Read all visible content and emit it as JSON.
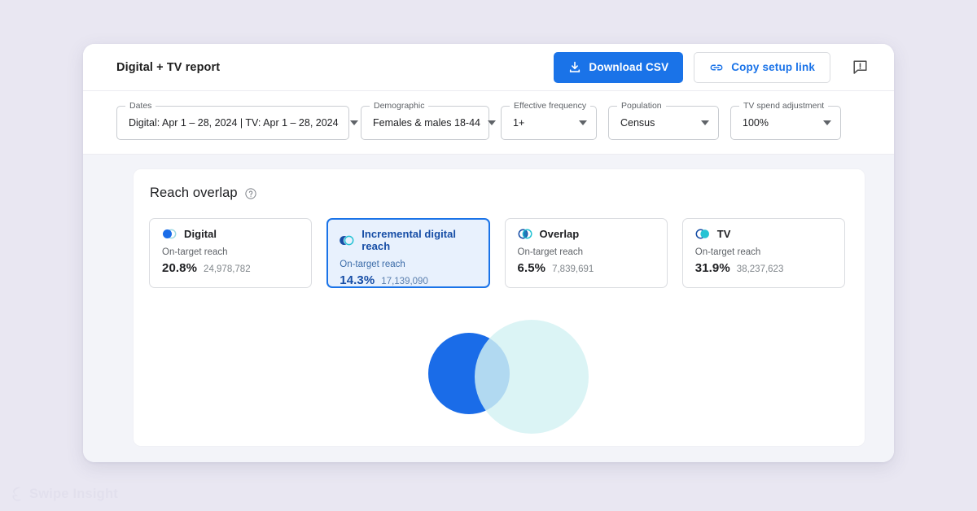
{
  "watermark": {
    "label": "Swipe Insight",
    "logo_icon": "swipe-s-logo-icon"
  },
  "window": {
    "title": "Digital + TV report",
    "actions": {
      "download_label": "Download CSV",
      "download_icon": "download-icon",
      "copy_label": "Copy setup link",
      "copy_icon": "link-icon",
      "feedback_icon": "feedback-comment-icon"
    }
  },
  "filters": [
    {
      "name": "dates",
      "label": "Dates",
      "value": "Digital: Apr 1 – 28, 2024 | TV: Apr 1 – 28, 2024"
    },
    {
      "name": "demographic",
      "label": "Demographic",
      "value": "Females & males 18-44"
    },
    {
      "name": "effective-frequency",
      "label": "Effective frequency",
      "value": "1+"
    },
    {
      "name": "population",
      "label": "Population",
      "value": "Census"
    },
    {
      "name": "tv-spend-adjustment",
      "label": "TV spend adjustment",
      "value": "100%"
    }
  ],
  "panel": {
    "title": "Reach overlap",
    "help_icon": "help-circle-icon",
    "metric_sublabel": "On-target reach",
    "cards": [
      {
        "name": "digital",
        "label": "Digital",
        "icon": "venn-digital-icon",
        "sublabel": "On-target reach",
        "percent": "20.8%",
        "absolute": "24,978,782",
        "selected": false
      },
      {
        "name": "incremental-digital-reach",
        "label": "Incremental digital reach",
        "icon": "venn-incremental-icon",
        "sublabel": "On-target reach",
        "percent": "14.3%",
        "absolute": "17,139,090",
        "selected": true
      },
      {
        "name": "overlap",
        "label": "Overlap",
        "icon": "venn-overlap-icon",
        "sublabel": "On-target reach",
        "percent": "6.5%",
        "absolute": "7,839,691",
        "selected": false
      },
      {
        "name": "tv",
        "label": "TV",
        "icon": "venn-tv-icon",
        "sublabel": "On-target reach",
        "percent": "31.9%",
        "absolute": "38,237,623",
        "selected": false
      }
    ]
  },
  "chart_data": {
    "type": "venn",
    "title": "Reach overlap",
    "sets": [
      {
        "name": "Digital",
        "label": "Digital",
        "percent": 20.8,
        "value": 24978782,
        "color": "#1a6ce8"
      },
      {
        "name": "TV",
        "label": "TV",
        "percent": 31.9,
        "value": 38237623,
        "color": "#ceeff1"
      }
    ],
    "intersections": [
      {
        "sets": [
          "Digital",
          "TV"
        ],
        "label": "Overlap",
        "percent": 6.5,
        "value": 7839691,
        "color": "#c5cfe2"
      }
    ],
    "derived": [
      {
        "name": "Incremental digital reach",
        "percent": 14.3,
        "value": 17139090
      }
    ],
    "ylabel": "",
    "xlabel": "",
    "legend": "none",
    "grid": false
  },
  "colors": {
    "accent": "#1a73e8",
    "digital": "#1a6ce8",
    "tv": "#ceeff1",
    "overlap": "#c5cfe2",
    "overlap_icon_teal": "#24c3d4",
    "page_background": "#e9e7f2",
    "panel_background": "#f3f4f9"
  }
}
